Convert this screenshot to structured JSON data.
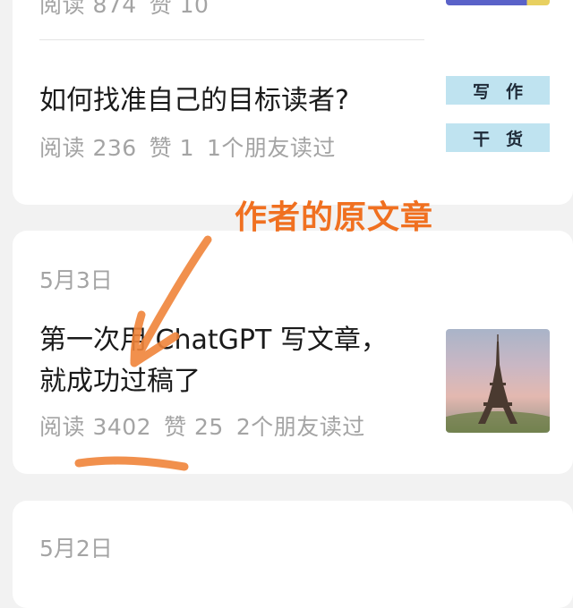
{
  "posts": [
    {
      "stats": {
        "reads": "阅读 874",
        "likes": "赞 10",
        "friends": ""
      }
    },
    {
      "title": "如何找准自己的目标读者?",
      "stats": {
        "reads": "阅读 236",
        "likes": "赞 1",
        "friends": "1个朋友读过"
      },
      "thumbnail_text": [
        "写",
        "作",
        "干",
        "货"
      ]
    },
    {
      "date": "5月3日",
      "title_line1": "第一次用 ChatGPT 写文章，",
      "title_line2": "就成功过稿了",
      "stats": {
        "reads": "阅读 3402",
        "likes": "赞 25",
        "friends": "2个朋友读过"
      },
      "thumbnail_icon": "eiffel-tower-photo"
    },
    {
      "date": "5月2日"
    }
  ],
  "annotation": {
    "text": "作者的原文章",
    "color": "#f07020"
  }
}
